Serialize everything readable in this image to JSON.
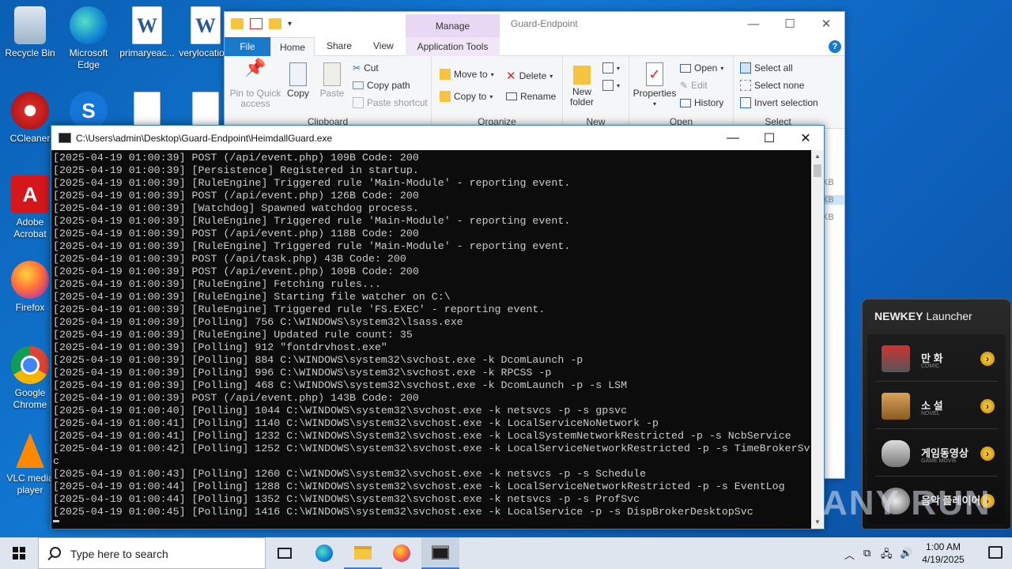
{
  "desktop_icons": [
    {
      "label": "Recycle Bin"
    },
    {
      "label": "Microsoft Edge"
    },
    {
      "label": "primaryeac..."
    },
    {
      "label": "verylocatio..."
    },
    {
      "label": "CCleaner"
    },
    {
      "label": "Adobe Acrobat"
    },
    {
      "label": "Firefox"
    },
    {
      "label": "Google Chrome"
    },
    {
      "label": "VLC media player"
    }
  ],
  "explorer": {
    "title": "Guard-Endpoint",
    "manage_label": "Manage",
    "tabs": {
      "file": "File",
      "home": "Home",
      "share": "Share",
      "view": "View",
      "app_tools": "Application Tools"
    },
    "clipboard": {
      "pin": "Pin to Quick access",
      "copy": "Copy",
      "paste": "Paste",
      "cut": "Cut",
      "copy_path": "Copy path",
      "paste_shortcut": "Paste shortcut",
      "group": "Clipboard"
    },
    "organize": {
      "move_to": "Move to",
      "copy_to": "Copy to",
      "delete": "Delete",
      "rename": "Rename",
      "group": "Organize"
    },
    "new": {
      "new_folder": "New folder",
      "group": "New"
    },
    "open": {
      "properties": "Properties",
      "open": "Open",
      "edit": "Edit",
      "history": "History",
      "group": "Open"
    },
    "select": {
      "select_all": "Select all",
      "select_none": "Select none",
      "invert": "Invert selection",
      "group": "Select"
    },
    "side_frags": [
      "KB",
      "KB",
      "KB"
    ]
  },
  "console": {
    "title": "C:\\Users\\admin\\Desktop\\Guard-Endpoint\\HeimdallGuard.exe",
    "lines": [
      "[2025-04-19 01:00:39] POST (/api/event.php) 109B Code: 200",
      "[2025-04-19 01:00:39] [Persistence] Registered in startup.",
      "[2025-04-19 01:00:39] [RuleEngine] Triggered rule 'Main-Module' - reporting event.",
      "[2025-04-19 01:00:39] POST (/api/event.php) 126B Code: 200",
      "[2025-04-19 01:00:39] [Watchdog] Spawned watchdog process.",
      "[2025-04-19 01:00:39] [RuleEngine] Triggered rule 'Main-Module' - reporting event.",
      "[2025-04-19 01:00:39] POST (/api/event.php) 118B Code: 200",
      "[2025-04-19 01:00:39] [RuleEngine] Triggered rule 'Main-Module' - reporting event.",
      "[2025-04-19 01:00:39] POST (/api/task.php) 43B Code: 200",
      "[2025-04-19 01:00:39] POST (/api/event.php) 109B Code: 200",
      "[2025-04-19 01:00:39] [RuleEngine] Fetching rules...",
      "[2025-04-19 01:00:39] [RuleEngine] Starting file watcher on C:\\",
      "[2025-04-19 01:00:39] [RuleEngine] Triggered rule 'FS.EXEC' - reporting event.",
      "[2025-04-19 01:00:39] [Polling] 756 C:\\WINDOWS\\system32\\lsass.exe",
      "[2025-04-19 01:00:39] [RuleEngine] Updated rule count: 35",
      "[2025-04-19 01:00:39] [Polling] 912 \"fontdrvhost.exe\"",
      "[2025-04-19 01:00:39] [Polling] 884 C:\\WINDOWS\\system32\\svchost.exe -k DcomLaunch -p",
      "[2025-04-19 01:00:39] [Polling] 996 C:\\WINDOWS\\system32\\svchost.exe -k RPCSS -p",
      "[2025-04-19 01:00:39] [Polling] 468 C:\\WINDOWS\\system32\\svchost.exe -k DcomLaunch -p -s LSM",
      "[2025-04-19 01:00:39] POST (/api/event.php) 143B Code: 200",
      "[2025-04-19 01:00:40] [Polling] 1044 C:\\WINDOWS\\system32\\svchost.exe -k netsvcs -p -s gpsvc",
      "[2025-04-19 01:00:41] [Polling] 1140 C:\\WINDOWS\\system32\\svchost.exe -k LocalServiceNoNetwork -p",
      "[2025-04-19 01:00:41] [Polling] 1232 C:\\WINDOWS\\System32\\svchost.exe -k LocalSystemNetworkRestricted -p -s NcbService",
      "[2025-04-19 01:00:42] [Polling] 1252 C:\\WINDOWS\\system32\\svchost.exe -k LocalServiceNetworkRestricted -p -s TimeBrokerSv",
      "c",
      "[2025-04-19 01:00:43] [Polling] 1260 C:\\WINDOWS\\system32\\svchost.exe -k netsvcs -p -s Schedule",
      "[2025-04-19 01:00:44] [Polling] 1288 C:\\WINDOWS\\system32\\svchost.exe -k LocalServiceNetworkRestricted -p -s EventLog",
      "[2025-04-19 01:00:44] [Polling] 1352 C:\\WINDOWS\\system32\\svchost.exe -k netsvcs -p -s ProfSvc",
      "[2025-04-19 01:00:45] [Polling] 1416 C:\\WINDOWS\\system32\\svchost.exe -k LocalService -p -s DispBrokerDesktopSvc"
    ]
  },
  "launcher": {
    "title_bold": "NEWKEY",
    "title_rest": " Launcher",
    "items": [
      {
        "name": "만 화",
        "sub": "COMIC"
      },
      {
        "name": "소 설",
        "sub": "NOVEL"
      },
      {
        "name": "게임동영상",
        "sub": "GAME MOVIE"
      },
      {
        "name": "음악 플레이어",
        "sub": ""
      }
    ]
  },
  "watermark": "ANY RUN",
  "taskbar": {
    "search_placeholder": "Type here to search",
    "time": "1:00 AM",
    "date": "4/19/2025"
  }
}
